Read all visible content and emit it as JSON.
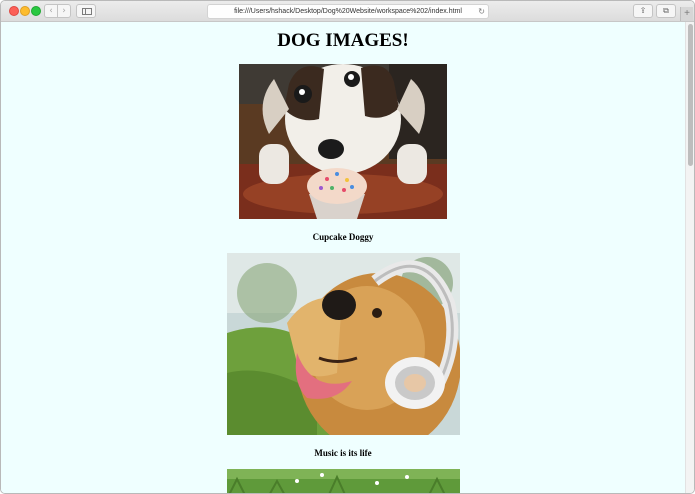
{
  "browser": {
    "url": "file:///Users/hshack/Desktop/Dog%20Website/workspace%202/index.html",
    "back_glyph": "‹",
    "forward_glyph": "›",
    "reload_glyph": "↻",
    "share_glyph": "⇪",
    "tabs_glyph": "⧉",
    "newtab_glyph": "+"
  },
  "page": {
    "heading": "DOG IMAGES!",
    "images": [
      {
        "caption": "Cupcake Doggy",
        "icon": "dog-cupcake-photo"
      },
      {
        "caption": "Music is its life",
        "icon": "dog-headphones-photo"
      },
      {
        "icon": "grass-dog-photo"
      }
    ]
  },
  "colors": {
    "page_background": "#efffff"
  }
}
